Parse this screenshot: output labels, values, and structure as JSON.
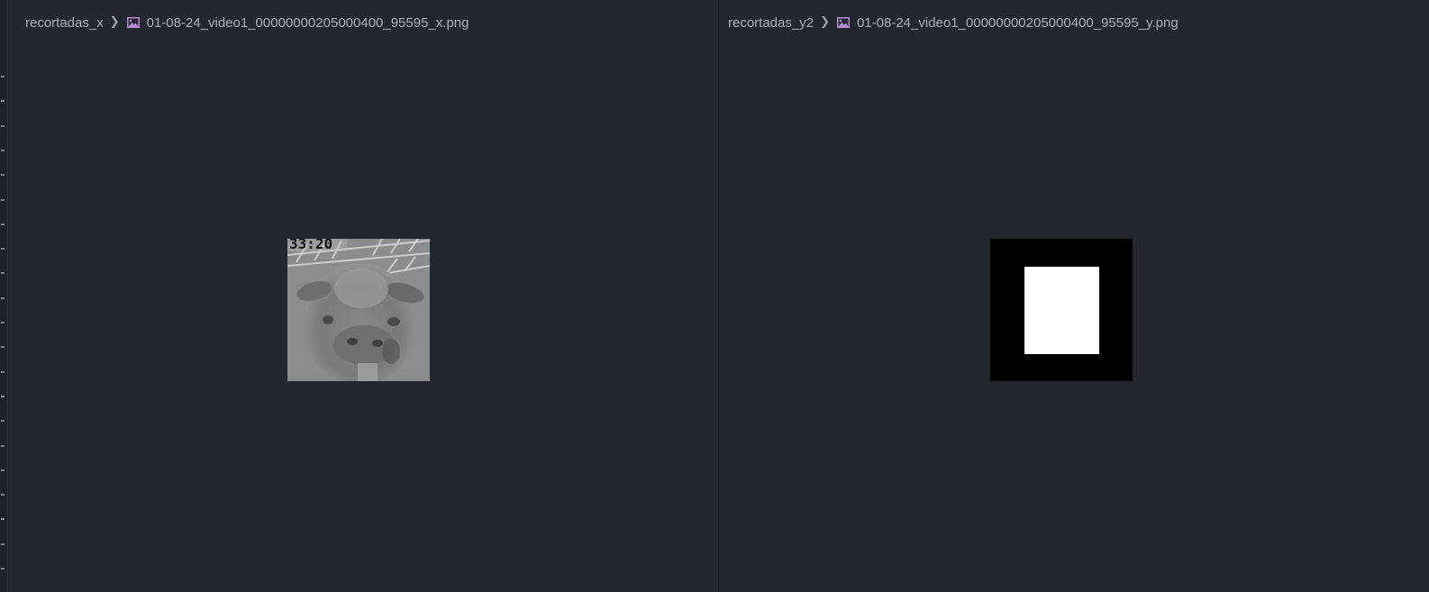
{
  "left_pane": {
    "folder": "recortadas_x",
    "separator": ">",
    "file_icon": "image-file-icon",
    "file_name": "01-08-24_video1_00000000205000400_95595_x.png",
    "image": {
      "description_icon": "cow-photo",
      "timestamp_overlay": "33:20"
    }
  },
  "right_pane": {
    "folder": "recortadas_y2",
    "separator": ">",
    "file_icon": "image-file-icon",
    "file_name": "01-08-24_video1_00000000205000400_95595_y.png",
    "image": {
      "description_icon": "binary-mask"
    }
  },
  "colors": {
    "background": "#23272e",
    "breadcrumb_text": "#a9b0ba",
    "file_icon": "#b58bd6",
    "mask_background": "#000000",
    "mask_foreground": "#ffffff"
  }
}
